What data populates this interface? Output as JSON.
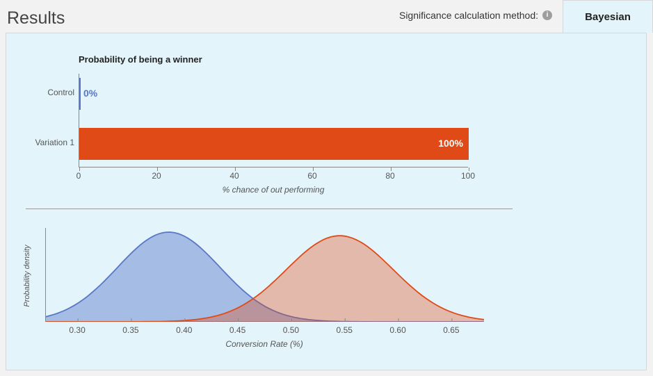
{
  "header": {
    "title": "Results",
    "sig_label": "Significance calculation method:",
    "tab_label": "Bayesian"
  },
  "colors": {
    "control": "#5877c7",
    "control_fill": "rgba(88,119,199,0.45)",
    "variation": "#e04a16",
    "variation_fill": "rgba(224,74,22,0.35)"
  },
  "chart_data": [
    {
      "id": "winner_bar",
      "type": "bar",
      "title": "Probability of being a winner",
      "xlabel": "% chance of out performing",
      "ylabel": "",
      "xlim": [
        0,
        100
      ],
      "x_ticks": [
        0,
        20,
        40,
        60,
        80,
        100
      ],
      "categories": [
        "Control",
        "Variation 1"
      ],
      "values": [
        0,
        100
      ],
      "value_labels": [
        "0%",
        "100%"
      ],
      "series_colors": [
        "#5877c7",
        "#e04a16"
      ]
    },
    {
      "id": "density",
      "type": "area",
      "title": "",
      "xlabel": "Conversion Rate (%)",
      "ylabel": "Probability density",
      "xlim": [
        0.27,
        0.68
      ],
      "ylim": [
        0,
        1
      ],
      "x_ticks": [
        0.3,
        0.35,
        0.4,
        0.45,
        0.5,
        0.55,
        0.6,
        0.65
      ],
      "series": [
        {
          "name": "Control",
          "color": "#5877c7",
          "fill": "rgba(88,119,199,0.45)",
          "mean": 0.385,
          "sd": 0.048,
          "peak_rel": 1.0
        },
        {
          "name": "Variation 1",
          "color": "#e04a16",
          "fill": "rgba(224,74,22,0.35)",
          "mean": 0.545,
          "sd": 0.05,
          "peak_rel": 0.96
        }
      ]
    }
  ]
}
